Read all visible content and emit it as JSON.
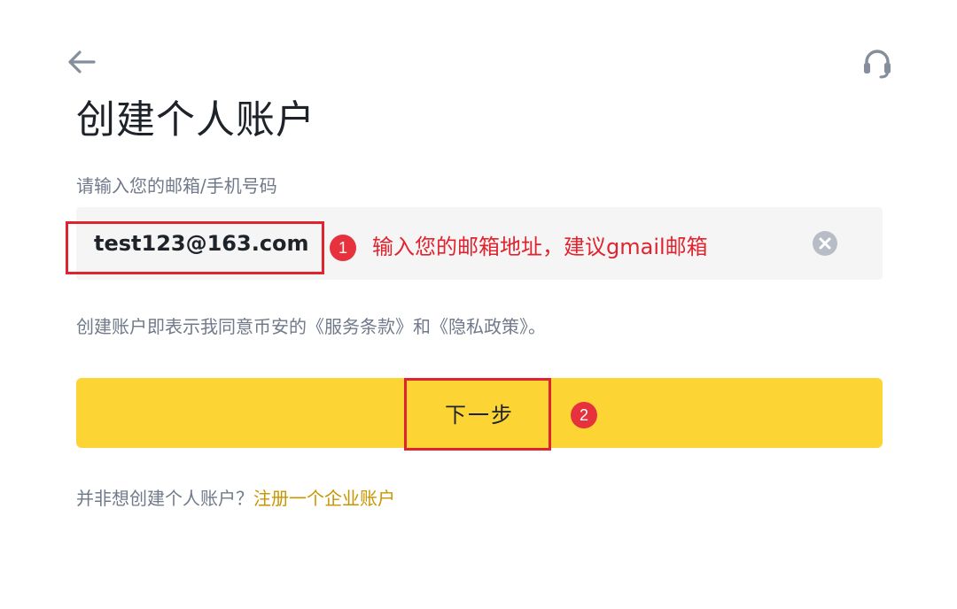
{
  "header": {
    "back_icon": "arrow-left-icon",
    "support_icon": "headset-icon"
  },
  "title": "创建个人账户",
  "form": {
    "label": "请输入您的邮箱/手机号码",
    "email_value": "test123@163.com",
    "clear_icon": "close-circle-icon"
  },
  "terms": {
    "text": "创建账户即表示我同意币安的《服务条款》和《隐私政策》。"
  },
  "next_button": {
    "label": "下一步"
  },
  "footer": {
    "question": "并非想创建个人账户？",
    "link": "注册一个企业账户"
  },
  "annotations": {
    "step1_number": "1",
    "step1_text": "输入您的邮箱地址，建议gmail邮箱",
    "step2_number": "2"
  },
  "colors": {
    "brand_yellow": "#fcd535",
    "link_gold": "#c99400",
    "annotation_red": "#e0242f",
    "text_primary": "#1e2329",
    "text_secondary": "#707a8a",
    "input_bg": "#f5f5f5"
  }
}
